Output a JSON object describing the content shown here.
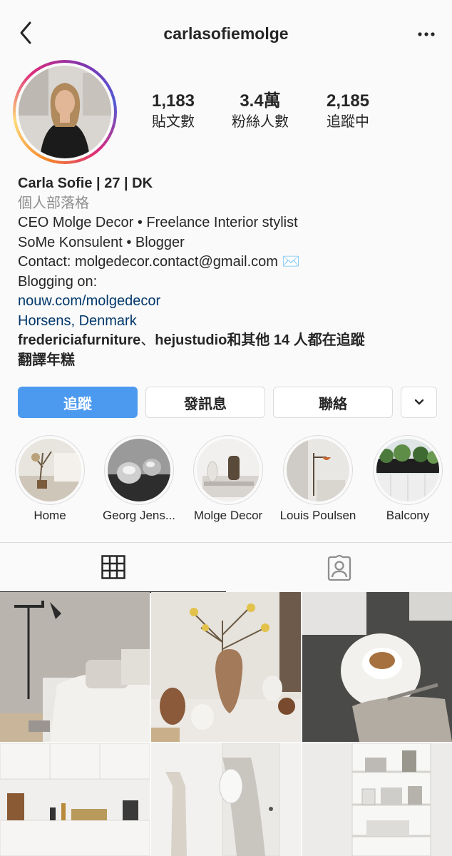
{
  "header": {
    "username": "carlasofiemolge"
  },
  "stats": [
    {
      "value": "1,183",
      "label": "貼文數"
    },
    {
      "value": "3.4萬",
      "label": "粉絲人數"
    },
    {
      "value": "2,185",
      "label": "追蹤中"
    }
  ],
  "bio": {
    "name": "Carla Sofie | 27 | DK",
    "category": "個人部落格",
    "line1": "CEO Molge Decor • Freelance Interior stylist",
    "line2": "SoMe Konsulent • Blogger",
    "line3": "Contact: molgedecor.contact@gmail.com ✉️",
    "line4": "Blogging on:",
    "website": "nouw.com/molgedecor",
    "location": "Horsens, Denmark",
    "followed_by_1": "fredericiafurniture",
    "followed_sep": "、",
    "followed_by_2": "hejustudio",
    "followed_rest": "和其他 14 人都在追蹤",
    "translate": "翻譯年糕"
  },
  "buttons": {
    "follow": "追蹤",
    "message": "發訊息",
    "contact": "聯絡"
  },
  "highlights": [
    {
      "label": "Home"
    },
    {
      "label": "Georg Jens..."
    },
    {
      "label": "Molge Decor"
    },
    {
      "label": "Louis Poulsen"
    },
    {
      "label": "Balcony"
    }
  ],
  "colors": {
    "follow_button": "#4c9af0",
    "link": "#00376b",
    "muted": "#8e8e8e"
  }
}
